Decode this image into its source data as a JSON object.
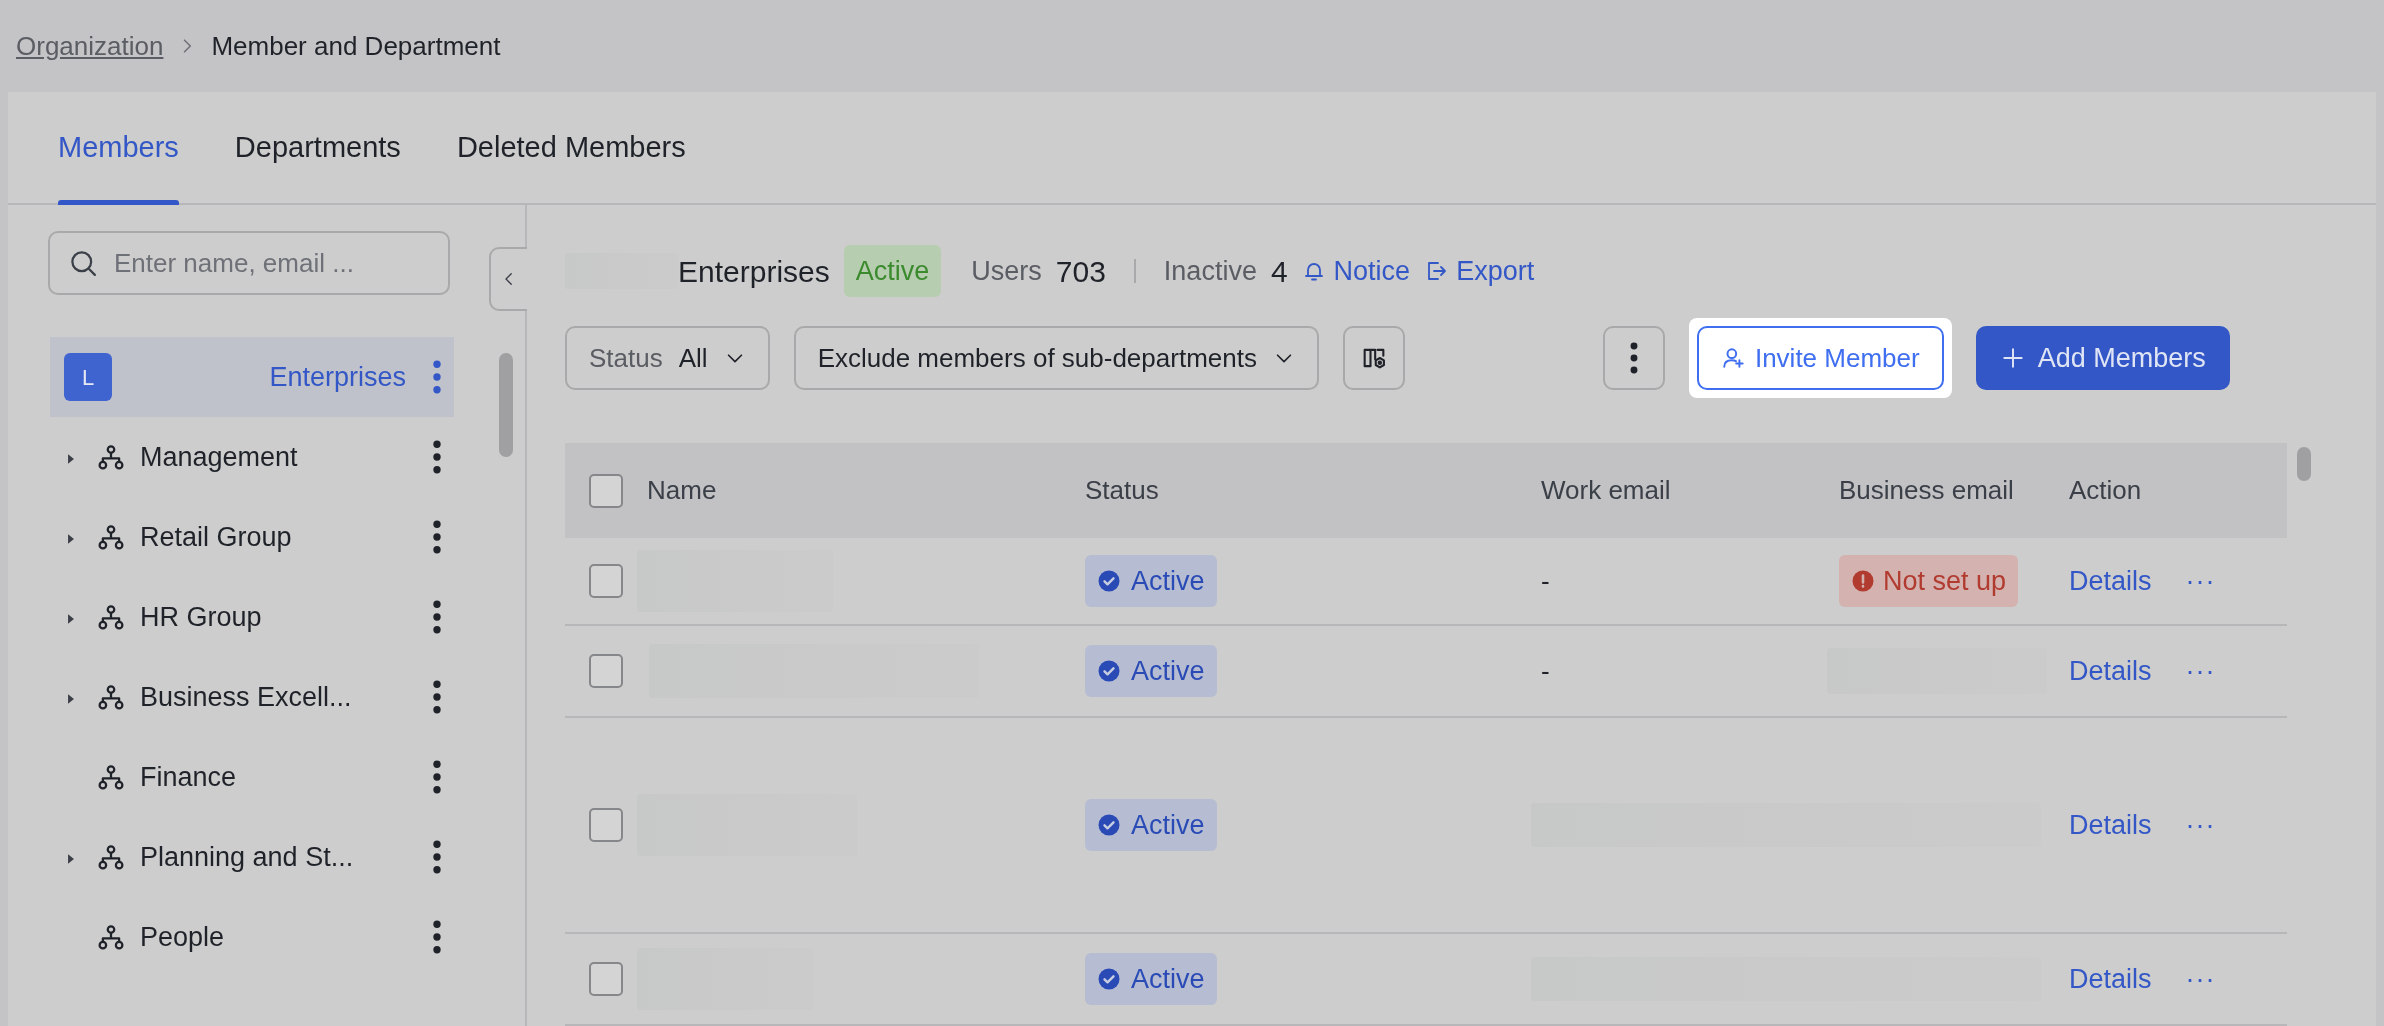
{
  "breadcrumb": [
    {
      "label": "Organization",
      "current": false
    },
    {
      "label": "Member and Department",
      "current": true
    }
  ],
  "tabs": [
    {
      "label": "Members",
      "selected": true
    },
    {
      "label": "Departments",
      "selected": false
    },
    {
      "label": "Deleted Members",
      "selected": false
    }
  ],
  "sidebar": {
    "search": {
      "placeholder": "Enter name, email ..."
    },
    "items": [
      {
        "label": "Enterprises",
        "avatar": "L",
        "selected": true
      },
      {
        "label": "Management",
        "expandable": true,
        "selected": false
      },
      {
        "label": "Retail Group",
        "expandable": true,
        "selected": false
      },
      {
        "label": "HR Group",
        "expandable": true,
        "selected": false
      },
      {
        "label": "Business Excell...",
        "expandable": true,
        "selected": false
      },
      {
        "label": "Finance",
        "expandable": false,
        "selected": false
      },
      {
        "label": "Planning and St...",
        "expandable": true,
        "selected": false
      },
      {
        "label": "People",
        "expandable": false,
        "selected": false
      }
    ]
  },
  "header": {
    "title": "Enterprises",
    "badge": "Active",
    "users_label": "Users",
    "users": "703",
    "inactive_label": "Inactive",
    "inactive": "4",
    "links": [
      {
        "label": "Notice",
        "kind": "bell"
      },
      {
        "label": "Export",
        "kind": "export"
      }
    ]
  },
  "toolbar": {
    "status_label": "Status",
    "status_value": "All",
    "scope": "Exclude members of sub-departments",
    "invite": {
      "label": "Invite Member",
      "highlighted": true
    },
    "add": "Add Members"
  },
  "table": {
    "select_all_checked": false,
    "columns": [
      "Name",
      "Status",
      "Work email",
      "Business email",
      "Action"
    ],
    "rows": [
      {
        "checked": false,
        "status": "Active",
        "work_email": "-",
        "business_email": "Not set up",
        "action": "Details",
        "more": "···",
        "tall": false
      },
      {
        "checked": false,
        "status": "Active",
        "work_email": "-",
        "action": "Details",
        "more": "···",
        "tall": false
      },
      {
        "checked": false,
        "status": "Active",
        "action": "Details",
        "more": "···",
        "tall": true
      },
      {
        "checked": false,
        "status": "Active",
        "action": "Details",
        "more": "···",
        "tall": false
      }
    ]
  }
}
